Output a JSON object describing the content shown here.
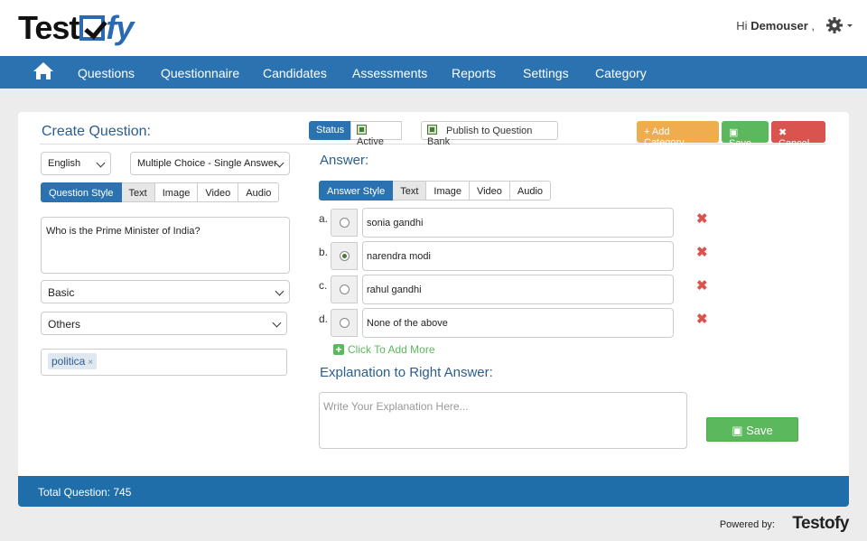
{
  "header": {
    "logo": {
      "part1": "Test",
      "part2": "fy"
    },
    "greeting_prefix": "Hi ",
    "username": "Demouser",
    "greeting_suffix": " ,",
    "settings_icon": "gear-icon"
  },
  "nav": {
    "home_icon": "home-icon",
    "items": [
      "Questions",
      "Questionnaire",
      "Candidates",
      "Assessments",
      "Reports",
      "Settings",
      "Category"
    ]
  },
  "form": {
    "title": "Create Question:",
    "status_label": "Status",
    "active_label": "Active",
    "publish_label": "Publish to Question Bank",
    "add_category_label": "+ Add Category",
    "save_label": "Save",
    "cancel_label": "Cancel",
    "language": "English",
    "question_type": "Multiple Choice - Single Answer",
    "question_tabs": [
      "Question Style",
      "Text",
      "Image",
      "Video",
      "Audio"
    ],
    "question_text": "Who is the Prime Minister of India?",
    "difficulty": "Basic",
    "category": "Others",
    "tags": [
      "politica"
    ]
  },
  "answer": {
    "label": "Answer:",
    "tabs": [
      "Answer Style",
      "Text",
      "Image",
      "Video",
      "Audio"
    ],
    "options": [
      {
        "letter": "a.",
        "text": "sonia gandhi",
        "selected": false
      },
      {
        "letter": "b.",
        "text": "narendra modi",
        "selected": true
      },
      {
        "letter": "c.",
        "text": "rahul gandhi",
        "selected": false
      },
      {
        "letter": "d.",
        "text": "None of the above",
        "selected": false
      }
    ],
    "add_more_label": "Click To Add More",
    "explanation_label": "Explanation to Right Answer:",
    "explanation_placeholder": "Write Your Explanation Here...",
    "save_label": "Save"
  },
  "footer": {
    "total_questions": "Total Question: 745",
    "powered_by": "Powered by:",
    "brand": "Testofy"
  },
  "colors": {
    "nav": "#2b73b0",
    "success": "#5cb85c",
    "warning": "#f0ad4e",
    "danger": "#d9534f"
  }
}
